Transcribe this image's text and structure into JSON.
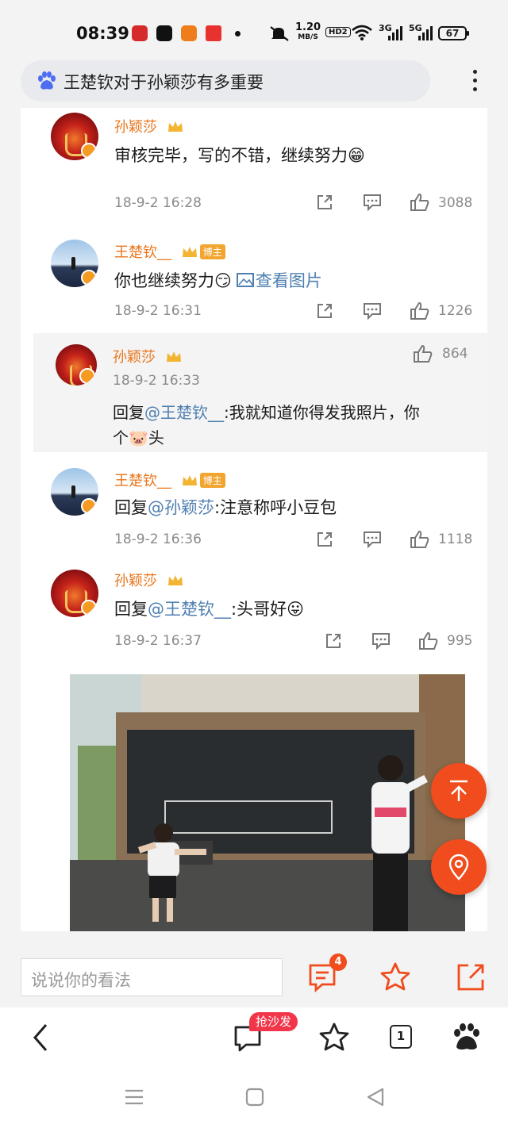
{
  "status_bar": {
    "time": "08:39",
    "net_speed": "1.20",
    "net_unit": "MB/S",
    "hd": "HD2",
    "sig1": "3G",
    "sig2": "5G",
    "battery": "67"
  },
  "search": {
    "query": "王楚钦对于孙颖莎有多重要"
  },
  "comments": [
    {
      "user": "孙颖莎",
      "text": "审核完毕，写的不错，继续努力",
      "emoji": "😁",
      "time": "18-9-2 16:28",
      "likes": "3088"
    },
    {
      "user": "王楚钦__",
      "tag": "博主",
      "text": "你也继续努力",
      "emoji": "😏",
      "link": "查看图片",
      "time": "18-9-2 16:31",
      "likes": "1226"
    },
    {
      "user": "孙颖莎",
      "time": "18-9-2 16:33",
      "likes": "864",
      "reply_prefix": "回复",
      "mention": "@王楚钦__",
      "text_line1": ":我就知道你得发我照片，你",
      "text_line2_a": "个",
      "emoji": "🐷",
      "text_line2_b": "头"
    },
    {
      "user": "王楚钦__",
      "tag": "博主",
      "reply_prefix": "回复",
      "mention": "@孙颖莎",
      "text": ":注意称呼小豆包",
      "time": "18-9-2 16:36",
      "likes": "1118"
    },
    {
      "user": "孙颖莎",
      "reply_prefix": "回复",
      "mention": "@王楚钦__",
      "text": ":头哥好",
      "emoji": "😛",
      "time": "18-9-2 16:37",
      "likes": "995"
    }
  ],
  "comment_bar": {
    "placeholder": "说说你的看法",
    "badge_count": "4"
  },
  "nav_bar": {
    "sofa_label": "抢沙发",
    "tab_count": "1"
  },
  "colors": {
    "accent": "#f04c1e",
    "username": "#e9751b",
    "mention": "#4f7fb0"
  }
}
